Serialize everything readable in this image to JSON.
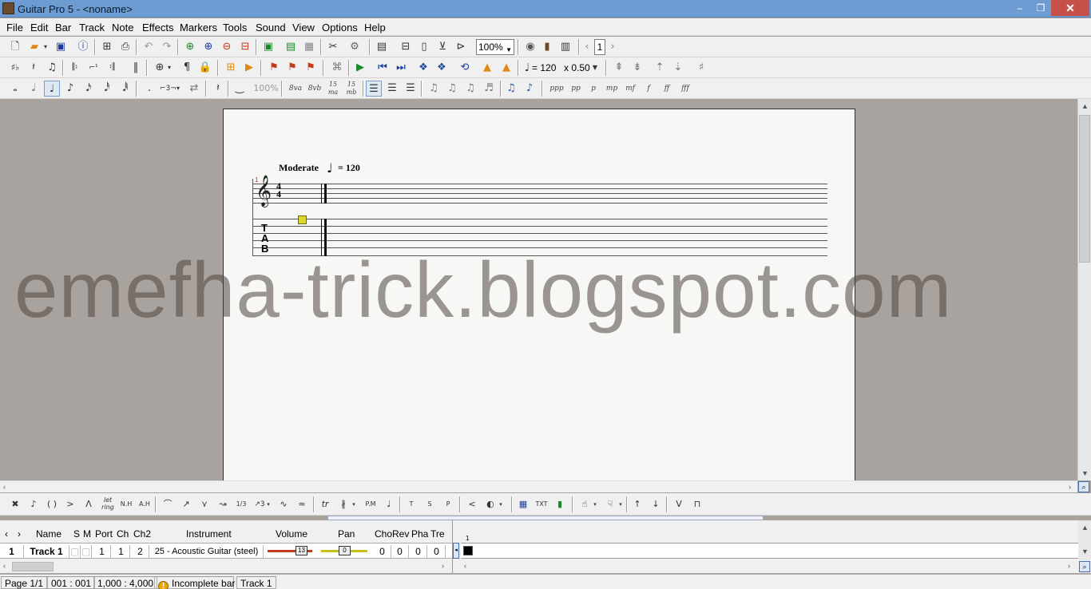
{
  "window": {
    "title": "Guitar Pro 5 - <noname>",
    "minimize": "–",
    "restore": "❐",
    "close": "✕"
  },
  "menu": [
    "File",
    "Edit",
    "Bar",
    "Track",
    "Note",
    "Effects",
    "Markers",
    "Tools",
    "Sound",
    "View",
    "Options",
    "Help"
  ],
  "toolbar": {
    "zoom": "100%",
    "bar_number": "1",
    "tempo_value": "= 120",
    "speed": "x 0.50",
    "velocity_percent": "100%",
    "ottava_8va": "8va",
    "ottava_8vb": "8vb",
    "quindicesima_ma": "15 ma",
    "quindicesima_mb": "15 mb"
  },
  "dynamics": [
    "ppp",
    "pp",
    "p",
    "mp",
    "mf",
    "f",
    "ff",
    "fff"
  ],
  "score": {
    "tempo_label": "Moderate",
    "tempo_equals": "= 120",
    "time_sig_top": "4",
    "time_sig_bottom": "4",
    "tab_letters": [
      "T",
      "A",
      "B"
    ],
    "bar_number": "1"
  },
  "watermark": "emefha-trick.blogspot.com",
  "effects_bar": {
    "pm": "P.M",
    "tap": "T",
    "slap": "S",
    "pop": "P",
    "txt": "TXT",
    "harm_nh": "N.H",
    "harm_ah": "A.H",
    "letring": "let ring",
    "triplet": "1/3",
    "trill": "tr"
  },
  "track_columns": {
    "name": "Name",
    "s": "S",
    "m": "M",
    "port": "Port",
    "ch": "Ch",
    "ch2": "Ch2",
    "instrument": "Instrument",
    "volume": "Volume",
    "pan": "Pan",
    "cho": "Cho",
    "rev": "Rev",
    "pha": "Pha",
    "tre": "Tre"
  },
  "track": {
    "number": "1",
    "name": "Track 1",
    "port": "1",
    "ch": "1",
    "ch2": "2",
    "instrument": "25 - Acoustic Guitar (steel)",
    "volume": "13",
    "pan": "0",
    "cho": "0",
    "rev": "0",
    "pha": "0",
    "tre": "0"
  },
  "timeline": {
    "bar_number": "1"
  },
  "status": {
    "page": "Page 1/1",
    "position": "001 : 001",
    "duration": "1,000 : 4,000",
    "warning": "Incomplete bar",
    "track": "Track 1"
  },
  "colors": {
    "titlebar": "#6c9cd1",
    "close": "#c7504b",
    "cursor": "#dcd52a",
    "volume": "#c23b1a",
    "pan": "#c9c017"
  }
}
